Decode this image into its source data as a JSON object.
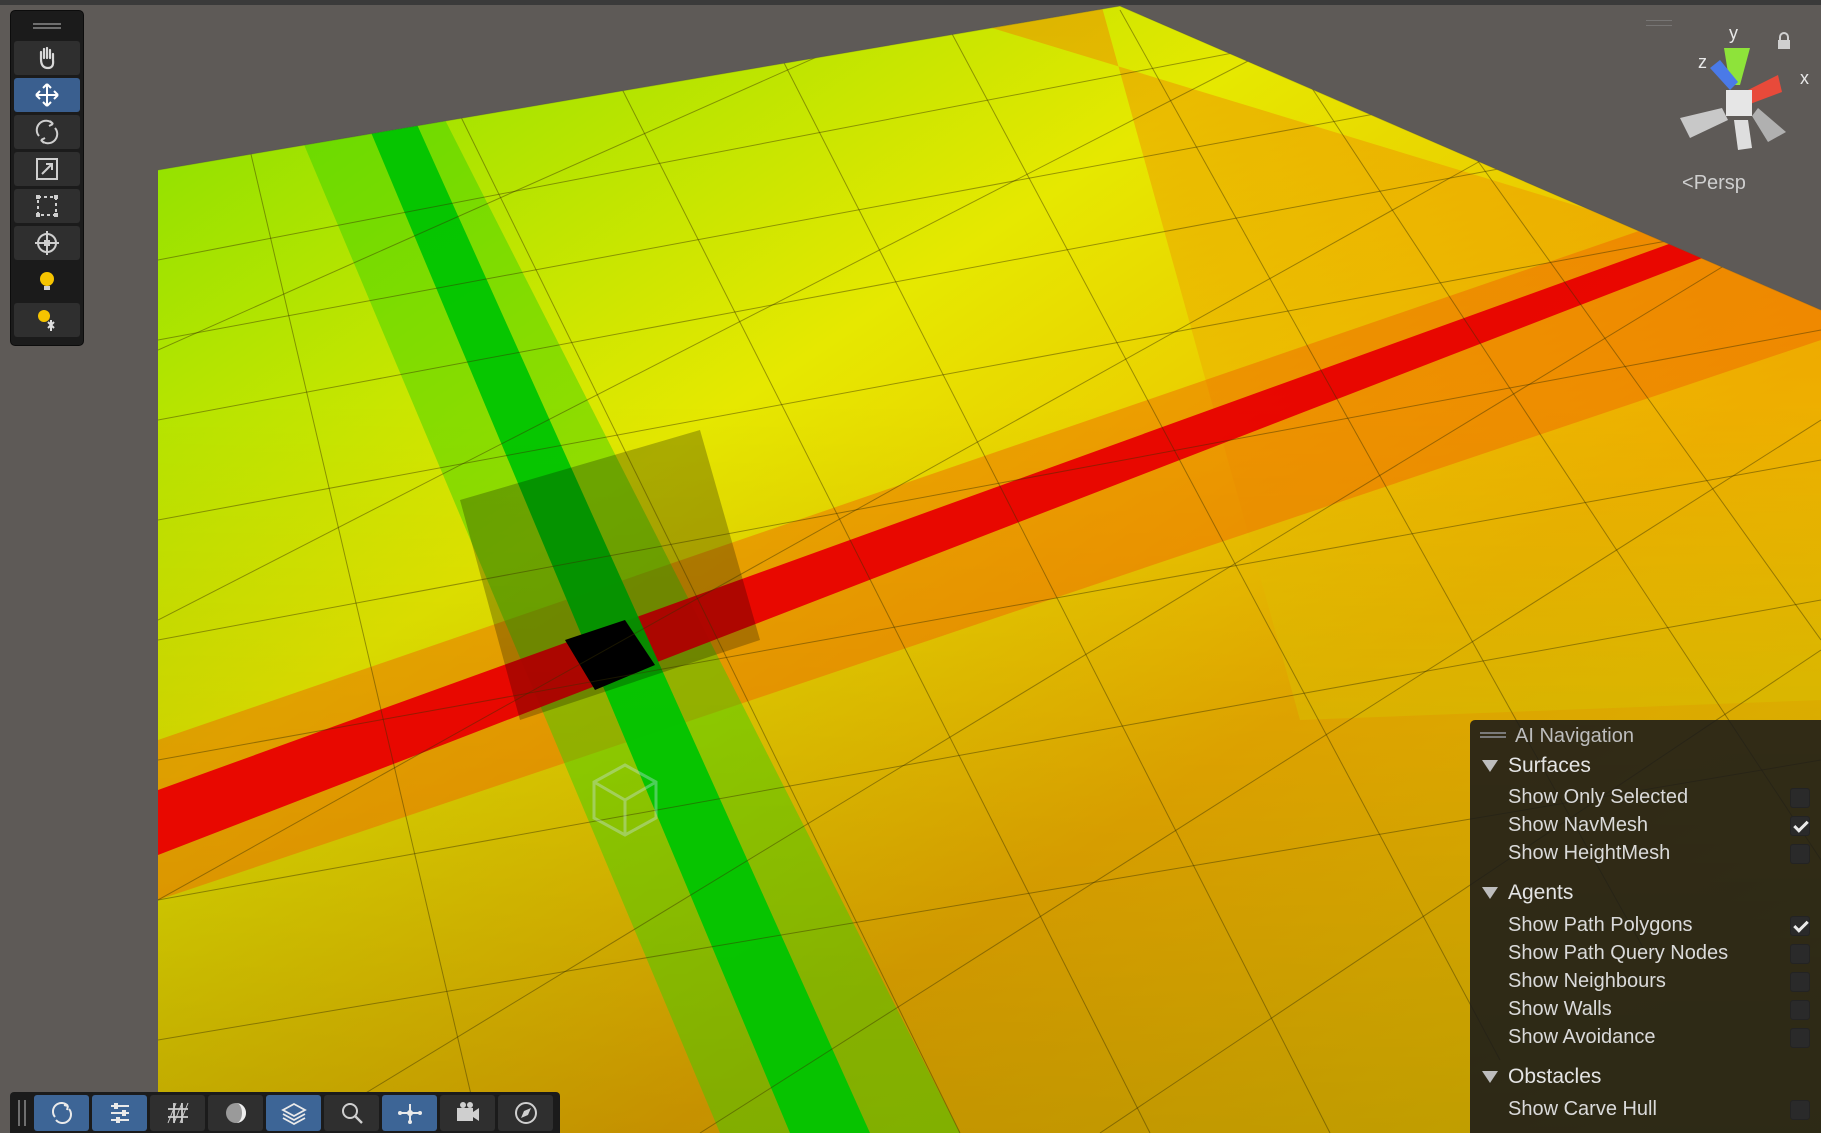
{
  "viewport": {
    "colors": {
      "background": "#5e5a57",
      "plane_green": "#7fe000",
      "plane_yellow": "#e6e800",
      "plane_orange": "#f0a000",
      "red_band": "#e80000",
      "green_band": "#00c000"
    }
  },
  "tools": [
    {
      "icon": "hand-icon",
      "active": false
    },
    {
      "icon": "move-icon",
      "active": true
    },
    {
      "icon": "rotate-icon",
      "active": false
    },
    {
      "icon": "scale-icon",
      "active": false
    },
    {
      "icon": "rect-icon",
      "active": false
    },
    {
      "icon": "transform-icon",
      "active": false
    },
    {
      "icon": "light-icon",
      "active": false
    },
    {
      "icon": "light-probe-icon",
      "active": false
    }
  ],
  "gizmo": {
    "axis_y": "y",
    "axis_x": "x",
    "axis_z": "z",
    "projection_label": "Persp"
  },
  "bottom_toolbar": [
    {
      "icon": "refresh-icon",
      "active": true
    },
    {
      "icon": "sliders-icon",
      "active": true
    },
    {
      "icon": "grid-icon",
      "active": false
    },
    {
      "icon": "shading-icon",
      "active": false
    },
    {
      "icon": "layers-icon",
      "active": true
    },
    {
      "icon": "search-icon",
      "active": false
    },
    {
      "icon": "navmesh-icon",
      "active": true
    },
    {
      "icon": "camera-icon",
      "active": false
    },
    {
      "icon": "compass-icon",
      "active": false
    }
  ],
  "ai_navigation": {
    "title": "AI Navigation",
    "sections": [
      {
        "label": "Surfaces",
        "options": [
          {
            "label": "Show Only Selected",
            "checked": false
          },
          {
            "label": "Show NavMesh",
            "checked": true
          },
          {
            "label": "Show HeightMesh",
            "checked": false
          }
        ]
      },
      {
        "label": "Agents",
        "options": [
          {
            "label": "Show Path Polygons",
            "checked": true
          },
          {
            "label": "Show Path Query Nodes",
            "checked": false
          },
          {
            "label": "Show Neighbours",
            "checked": false
          },
          {
            "label": "Show Walls",
            "checked": false
          },
          {
            "label": "Show Avoidance",
            "checked": false
          }
        ]
      },
      {
        "label": "Obstacles",
        "options": [
          {
            "label": "Show Carve Hull",
            "checked": false
          }
        ]
      }
    ]
  }
}
